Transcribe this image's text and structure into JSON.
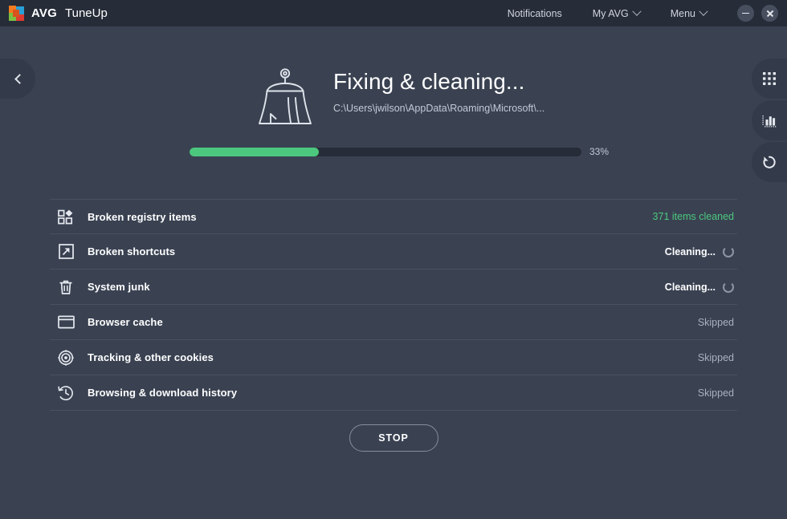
{
  "titlebar": {
    "brand_name": "AVG",
    "app_name": "TuneUp",
    "logo_icon": "avg-logo-icon",
    "links": [
      {
        "label": "Notifications",
        "has_caret": false,
        "name": "notifications"
      },
      {
        "label": "My AVG",
        "has_caret": true,
        "name": "my-avg"
      },
      {
        "label": "Menu",
        "has_caret": true,
        "name": "menu"
      }
    ],
    "minimize_icon": "minimize-icon",
    "close_icon": "close-icon"
  },
  "nav": {
    "back_icon": "chevron-left-icon",
    "right_tabs": [
      {
        "icon": "grid-apps-icon",
        "name": "all-tools"
      },
      {
        "icon": "bar-chart-icon",
        "name": "reports"
      },
      {
        "icon": "undo-restore-icon",
        "name": "rescue-center"
      }
    ]
  },
  "hero": {
    "icon": "broom-icon",
    "title": "Fixing & cleaning...",
    "subtitle": "C:\\Users\\jwilson\\AppData\\Roaming\\Microsoft\\..."
  },
  "progress": {
    "percent": 33,
    "percent_label": "33%",
    "fill_color": "#4cc87e",
    "track_color": "#262c38"
  },
  "list": {
    "rows": [
      {
        "label": "Broken registry items",
        "icon": "registry-blocks-icon",
        "status": "371 items cleaned",
        "status_kind": "done",
        "spinner": false
      },
      {
        "label": "Broken shortcuts",
        "icon": "shortcut-arrow-icon",
        "status": "Cleaning...",
        "status_kind": "working",
        "spinner": true
      },
      {
        "label": "System junk",
        "icon": "trash-bin-icon",
        "status": "Cleaning...",
        "status_kind": "working",
        "spinner": true
      },
      {
        "label": "Browser cache",
        "icon": "browser-window-icon",
        "status": "Skipped",
        "status_kind": "skipped",
        "spinner": false
      },
      {
        "label": "Tracking & other cookies",
        "icon": "target-circles-icon",
        "status": "Skipped",
        "status_kind": "skipped",
        "spinner": false
      },
      {
        "label": "Browsing & download history",
        "icon": "clock-history-icon",
        "status": "Skipped",
        "status_kind": "skipped",
        "spinner": false
      }
    ]
  },
  "actions": {
    "stop_label": "STOP"
  },
  "colors": {
    "background": "#3a4252",
    "titlebar": "#262c38",
    "accent_green": "#4cc87e",
    "muted_text": "#a9b0bd",
    "tab_background": "#333a49"
  }
}
